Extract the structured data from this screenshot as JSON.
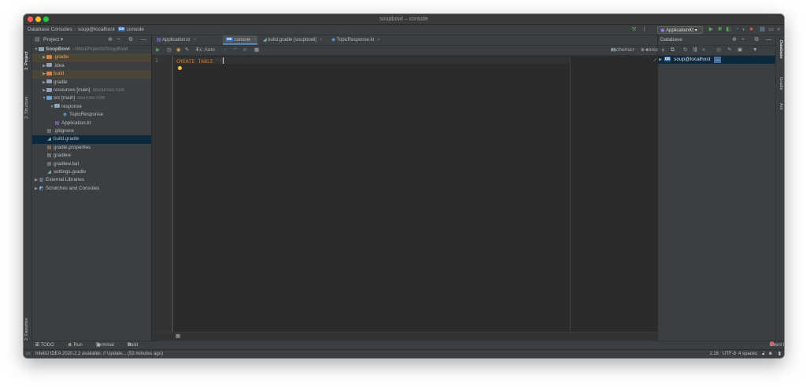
{
  "window": {
    "title": "soupbowl – console"
  },
  "navbar": {
    "crumbs": [
      "Database Consoles",
      "soup@localhost",
      "console"
    ],
    "run_config": "ApplicationKt"
  },
  "left_strip": {
    "tabs": [
      "1: Project",
      "2: Structure",
      "2: Favorites"
    ]
  },
  "right_strip": {
    "tabs": [
      "Database",
      "Gradle",
      "Ant"
    ]
  },
  "project_panel": {
    "title": "Project",
    "tree": [
      {
        "label": "SoupBowl",
        "hint": "~/IdeaProjects/SoupBowl",
        "depth": 0,
        "arrow": "down",
        "icon": "folder-module-icon"
      },
      {
        "label": ".gradle",
        "hint": "",
        "depth": 1,
        "arrow": "right",
        "icon": "folder-excluded-icon",
        "excluded": true
      },
      {
        "label": ".idea",
        "hint": "",
        "depth": 1,
        "arrow": "right",
        "icon": "folder-icon"
      },
      {
        "label": "build",
        "hint": "",
        "depth": 1,
        "arrow": "right",
        "icon": "folder-excluded-icon",
        "excluded": true
      },
      {
        "label": "gradle",
        "hint": "",
        "depth": 1,
        "arrow": "right",
        "icon": "folder-icon"
      },
      {
        "label": "resources [main]",
        "hint": "resources root",
        "depth": 1,
        "arrow": "right",
        "icon": "folder-resources-icon"
      },
      {
        "label": "src [main]",
        "hint": "sources root",
        "depth": 1,
        "arrow": "down",
        "icon": "folder-source-icon"
      },
      {
        "label": "response",
        "hint": "",
        "depth": 2,
        "arrow": "down",
        "icon": "package-icon"
      },
      {
        "label": "TopicResponse",
        "hint": "",
        "depth": 3,
        "arrow": "",
        "icon": "kotlin-class-icon"
      },
      {
        "label": "Application.kt",
        "hint": "",
        "depth": 2,
        "arrow": "",
        "icon": "kotlin-file-icon"
      },
      {
        "label": ".gitignore",
        "hint": "",
        "depth": 1,
        "arrow": "",
        "icon": "text-file-icon"
      },
      {
        "label": "build.gradle",
        "hint": "",
        "depth": 1,
        "arrow": "",
        "icon": "gradle-file-icon",
        "selected": true
      },
      {
        "label": "gradle.properties",
        "hint": "",
        "depth": 1,
        "arrow": "",
        "icon": "properties-file-icon"
      },
      {
        "label": "gradlew",
        "hint": "",
        "depth": 1,
        "arrow": "",
        "icon": "script-file-icon"
      },
      {
        "label": "gradlew.bat",
        "hint": "",
        "depth": 1,
        "arrow": "",
        "icon": "text-file-icon"
      },
      {
        "label": "settings.gradle",
        "hint": "",
        "depth": 1,
        "arrow": "",
        "icon": "gradle-file-icon"
      },
      {
        "label": "External Libraries",
        "hint": "",
        "depth": 0,
        "arrow": "right",
        "icon": "libraries-icon"
      },
      {
        "label": "Scratches and Consoles",
        "hint": "",
        "depth": 0,
        "arrow": "right",
        "icon": "scratches-icon"
      }
    ]
  },
  "editor": {
    "tabs": [
      "Application.kt",
      "console",
      "build.gradle (soupbowl)",
      "TopicResponse.kt"
    ],
    "active_tab": 1,
    "toolbar": {
      "tx_mode": "Tx: Auto",
      "schema": "<schema>",
      "console": "console"
    },
    "line_number": "1",
    "code_keyword": "CREATE TABLE",
    "code_string": "''"
  },
  "database_panel": {
    "title": "Database",
    "datasource": "soup@localhost",
    "ellipsis": "..."
  },
  "bottom_tools": [
    "6: TODO",
    "4: Run",
    "Terminal",
    "Build"
  ],
  "event_log": "Event Log",
  "status": {
    "message": "IntelliJ IDEA 2020.2.2 available: // Update... (53 minutes ago)",
    "position": "1:16",
    "encoding": "UTF-8",
    "indent": "4 spaces"
  },
  "colors": {
    "accent": "#4a88c7",
    "traffic_red": "#fe5f57",
    "traffic_yellow": "#febc2e",
    "traffic_green": "#28c840",
    "folder": "#8fa1b3",
    "excluded_folder": "#d7804b"
  }
}
